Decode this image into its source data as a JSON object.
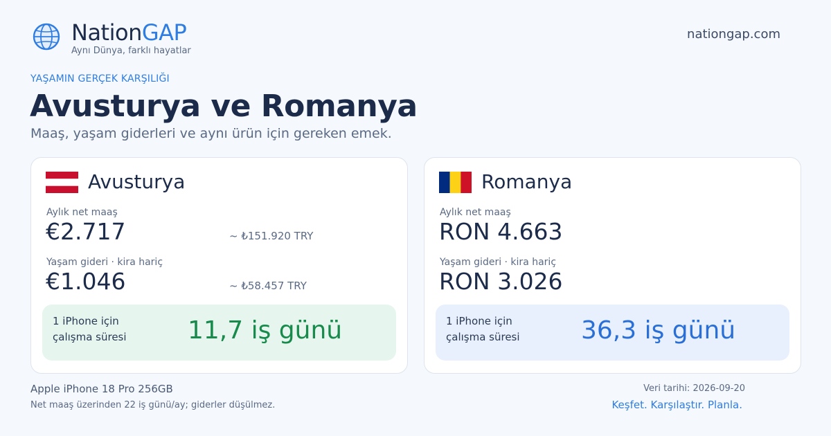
{
  "header": {
    "brand_part1": "Nation",
    "brand_part2": "GAP",
    "tagline": "Aynı Dünya, farklı hayatlar",
    "site": "nationgap.com",
    "logo_icon": "globe-icon"
  },
  "hero": {
    "eyebrow": "YAŞAMIN GERÇEK KARŞILIĞI",
    "title": "Avusturya ve Romanya",
    "subtitle": "Maaş, yaşam giderleri ve aynı ürün için gereken emek."
  },
  "cards": [
    {
      "country": "Avusturya",
      "flag_icon": "austria-flag-icon",
      "flag_colors": [
        "#c8102e",
        "#ffffff",
        "#c8102e"
      ],
      "salary_label": "Aylık net maaş",
      "salary_value": "€2.717",
      "salary_try": "~ ₺151.920 TRY",
      "cost_label": "Yaşam gideri · kira hariç",
      "cost_value": "€1.046",
      "cost_try": "~ ₺58.457 TRY",
      "iphone_label": "1 iPhone için çalışma süresi",
      "iphone_value": "11,7 iş günü",
      "accent": "#178a4c"
    },
    {
      "country": "Romanya",
      "flag_icon": "romania-flag-icon",
      "flag_colors": [
        "#002b7f",
        "#fcd116",
        "#ce1126"
      ],
      "salary_label": "Aylık net maaş",
      "salary_value": "RON 4.663",
      "cost_label": "Yaşam gideri · kira hariç",
      "cost_value": "RON 3.026",
      "iphone_label": "1 iPhone için çalışma süresi",
      "iphone_value": "36,3 iş günü",
      "accent": "#2a6fd6"
    }
  ],
  "footer": {
    "product": "Apple iPhone 18 Pro 256GB",
    "note": "Net maaş üzerinden 22 iş günü/ay; giderler düşülmez.",
    "date": "Veri tarihi: 2026-09-20",
    "slogan": "Keşfet. Karşılaştır. Planla."
  },
  "colors": {
    "brand_blue": "#2f7de1",
    "text_dark": "#1c2b4a",
    "background": "#f5f8fc"
  }
}
